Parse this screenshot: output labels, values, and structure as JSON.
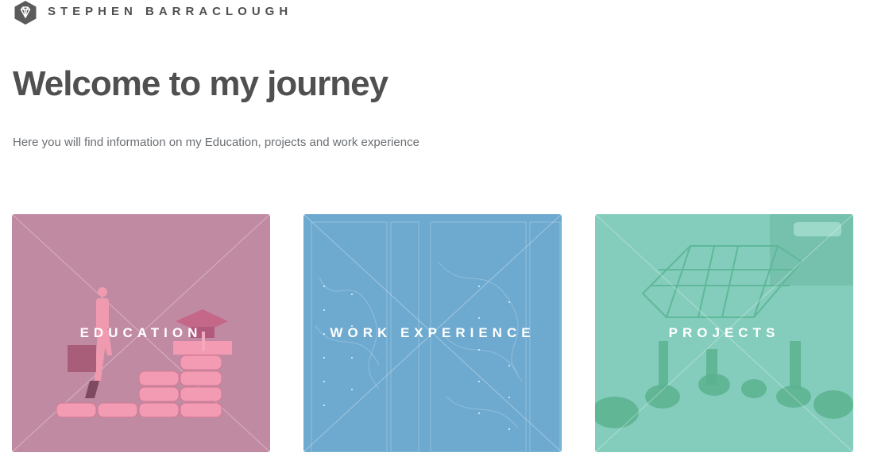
{
  "header": {
    "logo_icon": "diamond-icon",
    "site_name": "STEPHEN BARRACLOUGH"
  },
  "main": {
    "title": "Welcome to my journey",
    "subtitle": "Here you will find information on my Education, projects and work experience"
  },
  "tiles": [
    {
      "label": "EDUCATION",
      "color": "#c18aa3",
      "image": "student-climbing-books-illustration"
    },
    {
      "label": "WORK EXPERIENCE",
      "color": "#6ea9cf",
      "image": "server-rack-cables-photo"
    },
    {
      "label": "PROJECTS",
      "color": "#84cdbc",
      "image": "3d-printed-figures-photo"
    }
  ],
  "colors": {
    "text_dark": "#505050",
    "text_muted": "#6a6e73"
  }
}
